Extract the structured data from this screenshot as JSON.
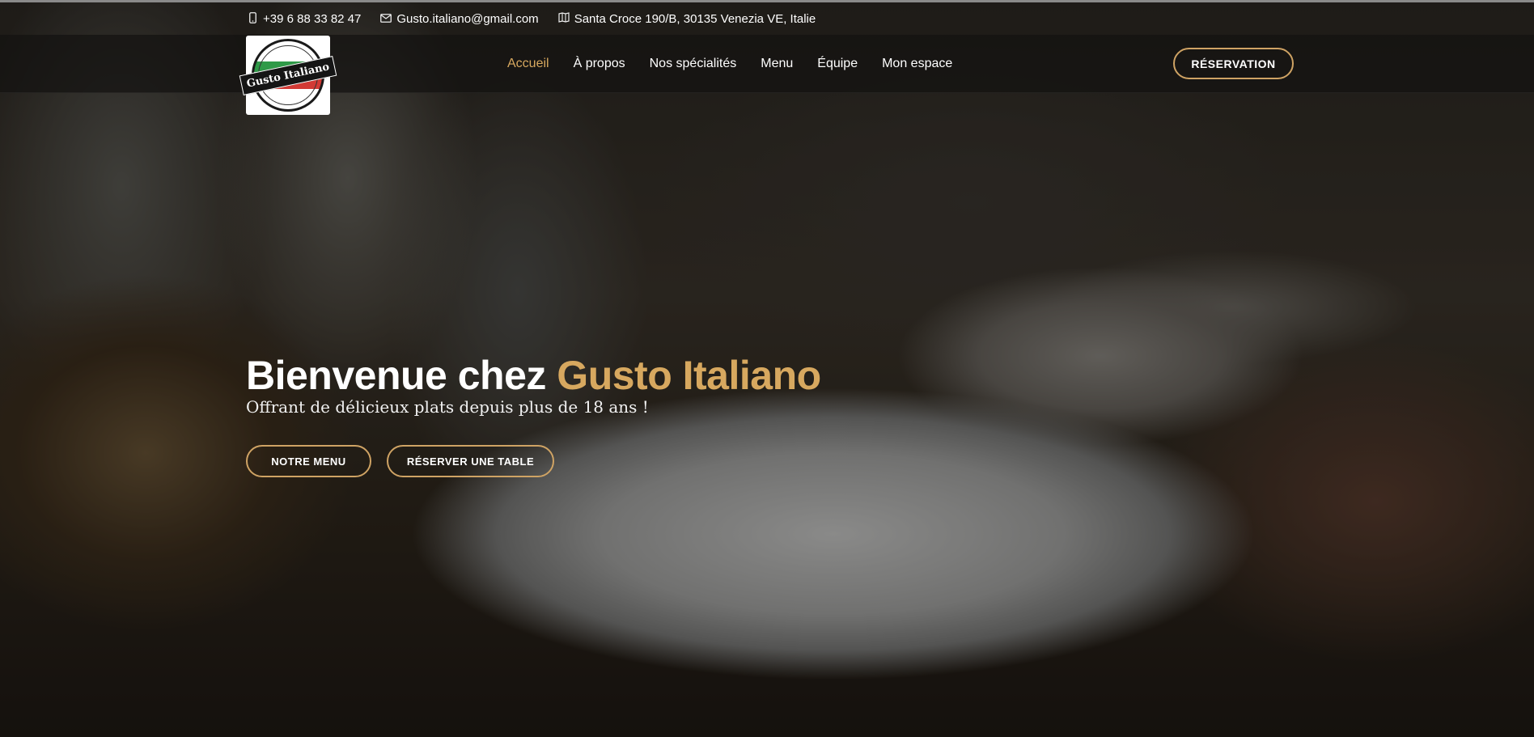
{
  "topbar": {
    "phone": "+39 6 88 33 82 47",
    "email": "Gusto.italiano@gmail.com",
    "address": "Santa Croce 190/B, 30135 Venezia VE, Italie",
    "icons": [
      "phone-icon",
      "envelope-icon",
      "map-icon"
    ]
  },
  "logo": {
    "name": "Gusto Italiano"
  },
  "nav": {
    "items": [
      {
        "label": "Accueil",
        "active": true
      },
      {
        "label": "À propos"
      },
      {
        "label": "Nos spécialités"
      },
      {
        "label": "Menu"
      },
      {
        "label": "Équipe"
      },
      {
        "label": "Mon espace"
      }
    ],
    "reservation_label": "RÉSERVATION"
  },
  "hero": {
    "title_prefix": "Bienvenue chez ",
    "title_brand": "Gusto Italiano",
    "subtitle": "Offrant de délicieux plats depuis plus de 18 ans !",
    "btn_menu": "NOTRE MENU",
    "btn_table": "RÉSERVER UNE TABLE"
  },
  "colors": {
    "accent": "#d7a85f",
    "button_border": "#cfa364"
  }
}
